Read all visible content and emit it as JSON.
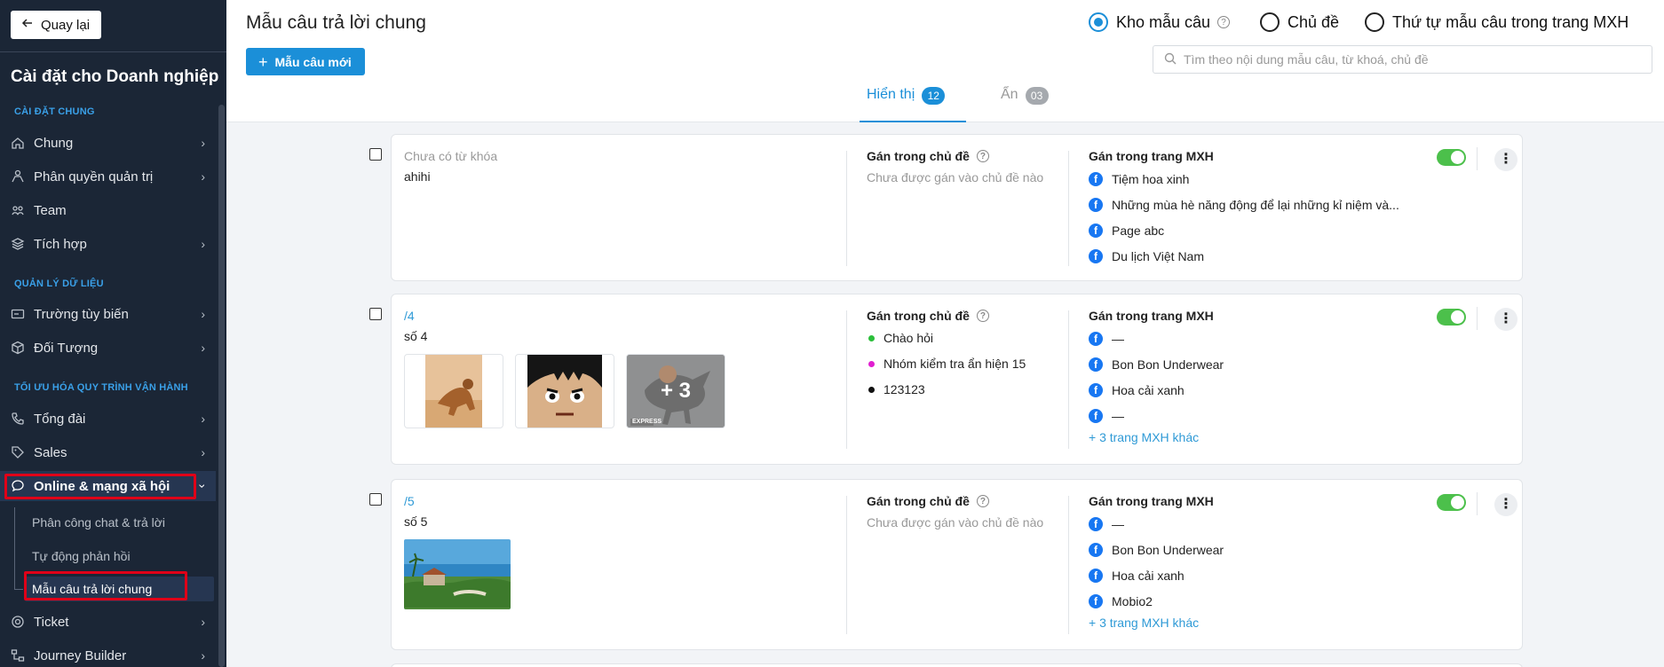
{
  "sidebar": {
    "back_label": "Quay lại",
    "title": "Cài đặt cho Doanh nghiệp",
    "sections": {
      "general": "CÀI ĐẶT CHUNG",
      "data": "QUẢN LÝ DỮ LIỆU",
      "process": "TỐI ƯU HÓA QUY TRÌNH VẬN HÀNH"
    },
    "items": {
      "chung": "Chung",
      "phanquyen": "Phân quyền quản trị",
      "team": "Team",
      "tichhop": "Tích hợp",
      "truongtuybien": "Trường tùy biến",
      "doituong": "Đối Tượng",
      "tongdai": "Tổng đài",
      "sales": "Sales",
      "online": "Online & mạng xã hội",
      "ticket": "Ticket",
      "journey": "Journey Builder"
    },
    "subitems": {
      "phancong": "Phân công chat & trả lời",
      "tudong": "Tự động phản hồi",
      "maucau": "Mẫu câu trả lời chung"
    }
  },
  "header": {
    "title": "Mẫu câu trả lời chung",
    "new_button": "Mẫu câu mới",
    "radios": {
      "kho": "Kho mẫu câu",
      "chude": "Chủ đề",
      "thutu": "Thứ tự mẫu câu trong trang MXH"
    },
    "search_placeholder": "Tìm theo nội dung mẫu câu, từ khoá, chủ đề",
    "tabs": {
      "show_label": "Hiển thị",
      "show_count": "12",
      "hide_label": "Ẩn",
      "hide_count": "03"
    }
  },
  "columns": {
    "topic_header": "Gán trong chủ đề",
    "page_header": "Gán trong trang MXH",
    "no_topic": "Chưa được gán vào chủ đề nào",
    "no_keyword": "Chưa có từ khóa"
  },
  "cards": [
    {
      "text": "ahihi",
      "pages": [
        "Tiệm hoa xinh",
        "Những mùa hè năng động để lại những kỉ niệm và...",
        "Page abc",
        "Du lịch Việt Nam"
      ]
    },
    {
      "keyword": "/4",
      "text": "số 4",
      "topics": [
        "Chào hỏi",
        "Nhóm kiểm tra ẩn hiện 15",
        "123123"
      ],
      "pages": [
        "—",
        "Bon Bon Underwear",
        "Hoa cải xanh",
        "—"
      ],
      "more_pages": "+ 3 trang MXH khác",
      "image_overlay": "+ 3",
      "image_caption": "EXPRESS"
    },
    {
      "keyword": "/5",
      "text": "số 5",
      "pages": [
        "—",
        "Bon Bon Underwear",
        "Hoa cải xanh",
        "Mobio2"
      ],
      "more_pages": "+ 3 trang MXH khác"
    }
  ],
  "colors": {
    "accent": "#1b8fd8",
    "sidebar_bg": "#1b2636",
    "toggle_on": "#4cc04b",
    "highlight": "#e00018",
    "topic_dots": [
      "#2bbf3a",
      "#e01fd0",
      "#111111"
    ]
  }
}
